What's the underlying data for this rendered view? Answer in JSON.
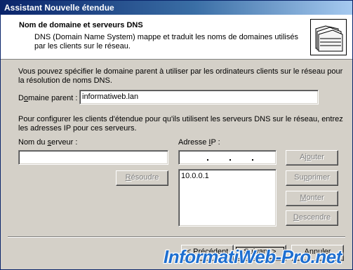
{
  "window": {
    "title": "Assistant Nouvelle étendue"
  },
  "header": {
    "title": "Nom de domaine et serveurs DNS",
    "description": "DNS (Domain Name System) mappe et traduit les noms de domaines utilisés par les clients sur le réseau."
  },
  "intro_text": "Vous pouvez spécifier le domaine parent à utiliser par les ordinateurs clients sur le réseau pour la résolution de noms DNS.",
  "parent_domain": {
    "label_pre": "D",
    "label_ul": "o",
    "label_post": "maine parent :",
    "value": "informatiweb.lan"
  },
  "config_text": "Pour configurer les clients d'étendue pour qu'ils utilisent les serveurs DNS sur le réseau, entrez les adresses IP pour ces serveurs.",
  "server_name": {
    "label_pre": "Nom du ",
    "label_ul": "s",
    "label_post": "erveur :",
    "value": ""
  },
  "ip_address": {
    "label_pre": "Adresse ",
    "label_ul": "I",
    "label_post": "P :",
    "value": ""
  },
  "resolve_button": {
    "label_pre": "",
    "label_ul": "R",
    "label_post": "ésoudre"
  },
  "ip_list": [
    "10.0.0.1"
  ],
  "side_buttons": {
    "add": {
      "label_pre": "Aj",
      "label_ul": "o",
      "label_post": "uter"
    },
    "remove": {
      "label_pre": "Su",
      "label_ul": "p",
      "label_post": "primer"
    },
    "up": {
      "label_pre": "",
      "label_ul": "M",
      "label_post": "onter"
    },
    "down": {
      "label_pre": "",
      "label_ul": "D",
      "label_post": "escendre"
    }
  },
  "nav_buttons": {
    "back": "< Précédent",
    "next": "Suivant >",
    "cancel": "Annuler"
  },
  "watermark": "InformatiWeb-Pro.net"
}
